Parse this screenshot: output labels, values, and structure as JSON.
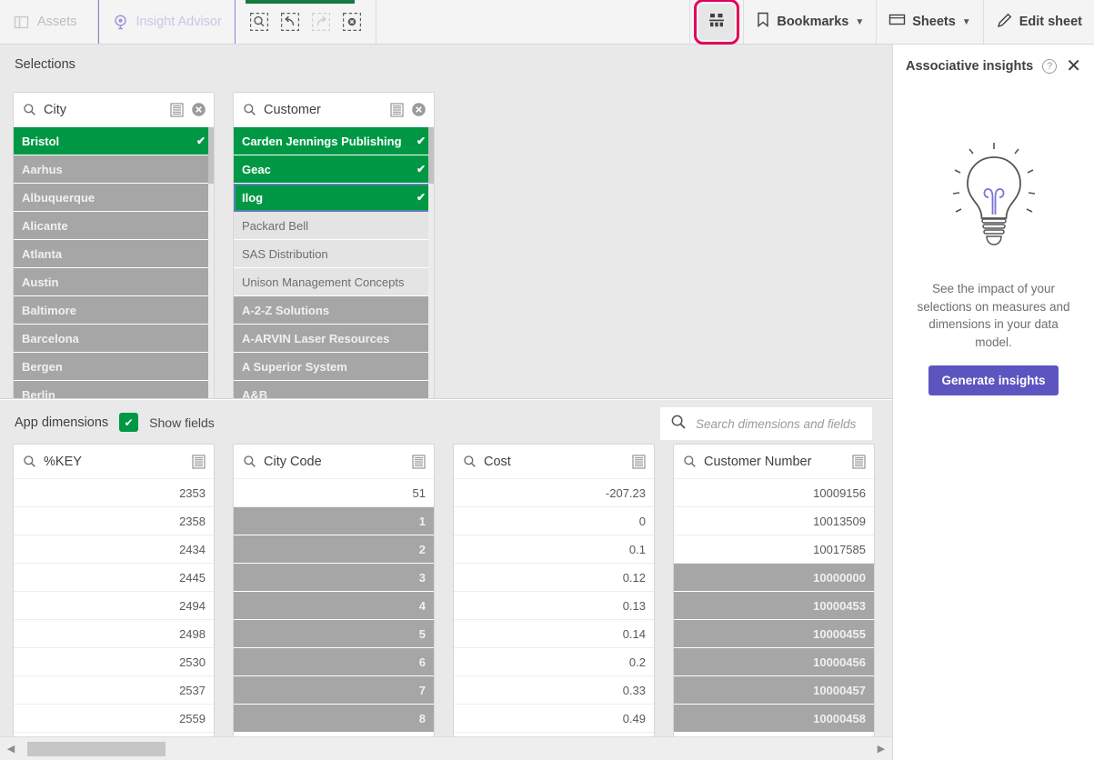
{
  "toolbar": {
    "assets_label": "Assets",
    "insight_advisor_label": "Insight Advisor",
    "tools": [
      {
        "name": "selection-search-icon"
      },
      {
        "name": "step-back-icon"
      },
      {
        "name": "step-forward-icon"
      },
      {
        "name": "clear-all-selections-icon"
      }
    ],
    "chart_button_name": "chart-view-button",
    "bookmarks_label": "Bookmarks",
    "sheets_label": "Sheets",
    "edit_sheet_label": "Edit sheet",
    "highlight_color": "#e2005a",
    "active_tab_underline_color": "#157a3d"
  },
  "selections": {
    "title": "Selections",
    "listboxes": [
      {
        "title": "City",
        "rows": [
          {
            "label": "Bristol",
            "state": "selected",
            "checked": true
          },
          {
            "label": "Aarhus",
            "state": "excluded"
          },
          {
            "label": "Albuquerque",
            "state": "excluded"
          },
          {
            "label": "Alicante",
            "state": "excluded"
          },
          {
            "label": "Atlanta",
            "state": "excluded"
          },
          {
            "label": "Austin",
            "state": "excluded"
          },
          {
            "label": "Baltimore",
            "state": "excluded"
          },
          {
            "label": "Barcelona",
            "state": "excluded"
          },
          {
            "label": "Bergen",
            "state": "excluded"
          },
          {
            "label": "Berlin",
            "state": "excluded"
          }
        ]
      },
      {
        "title": "Customer",
        "rows": [
          {
            "label": "Carden Jennings Publishing",
            "state": "selected",
            "checked": true
          },
          {
            "label": "Geac",
            "state": "selected",
            "checked": true
          },
          {
            "label": "Ilog",
            "state": "selected",
            "checked": true,
            "focused": true
          },
          {
            "label": "Packard Bell",
            "state": "alt"
          },
          {
            "label": "SAS Distribution",
            "state": "alt"
          },
          {
            "label": "Unison Management Concepts",
            "state": "alt"
          },
          {
            "label": "A-2-Z Solutions",
            "state": "excluded"
          },
          {
            "label": "A-ARVIN Laser Resources",
            "state": "excluded"
          },
          {
            "label": "A Superior System",
            "state": "excluded"
          },
          {
            "label": "A&B",
            "state": "excluded"
          }
        ]
      }
    ]
  },
  "app_dimensions": {
    "title": "App dimensions",
    "show_fields_label": "Show fields",
    "show_fields_checked": true,
    "search_placeholder": "Search dimensions and fields",
    "fields": [
      {
        "title": "%KEY",
        "rows": [
          {
            "label": "2353",
            "state": "optional"
          },
          {
            "label": "2358",
            "state": "optional"
          },
          {
            "label": "2434",
            "state": "optional"
          },
          {
            "label": "2445",
            "state": "optional"
          },
          {
            "label": "2494",
            "state": "optional"
          },
          {
            "label": "2498",
            "state": "optional"
          },
          {
            "label": "2530",
            "state": "optional"
          },
          {
            "label": "2537",
            "state": "optional"
          },
          {
            "label": "2559",
            "state": "optional"
          }
        ]
      },
      {
        "title": "City Code",
        "rows": [
          {
            "label": "51",
            "state": "optional"
          },
          {
            "label": "1",
            "state": "excluded"
          },
          {
            "label": "2",
            "state": "excluded"
          },
          {
            "label": "3",
            "state": "excluded"
          },
          {
            "label": "4",
            "state": "excluded"
          },
          {
            "label": "5",
            "state": "excluded"
          },
          {
            "label": "6",
            "state": "excluded"
          },
          {
            "label": "7",
            "state": "excluded"
          },
          {
            "label": "8",
            "state": "excluded"
          }
        ]
      },
      {
        "title": "Cost",
        "rows": [
          {
            "label": "-207.23",
            "state": "optional"
          },
          {
            "label": "0",
            "state": "optional"
          },
          {
            "label": "0.1",
            "state": "optional"
          },
          {
            "label": "0.12",
            "state": "optional"
          },
          {
            "label": "0.13",
            "state": "optional"
          },
          {
            "label": "0.14",
            "state": "optional"
          },
          {
            "label": "0.2",
            "state": "optional"
          },
          {
            "label": "0.33",
            "state": "optional"
          },
          {
            "label": "0.49",
            "state": "optional"
          }
        ]
      },
      {
        "title": "Customer Number",
        "rows": [
          {
            "label": "10009156",
            "state": "optional"
          },
          {
            "label": "10013509",
            "state": "optional"
          },
          {
            "label": "10017585",
            "state": "optional"
          },
          {
            "label": "10000000",
            "state": "excluded"
          },
          {
            "label": "10000453",
            "state": "excluded"
          },
          {
            "label": "10000455",
            "state": "excluded"
          },
          {
            "label": "10000456",
            "state": "excluded"
          },
          {
            "label": "10000457",
            "state": "excluded"
          },
          {
            "label": "10000458",
            "state": "excluded"
          }
        ]
      }
    ]
  },
  "insights": {
    "title": "Associative insights",
    "help_label": "?",
    "close_label": "✕",
    "description": "See the impact of your selections on measures and dimensions in your data model.",
    "button_label": "Generate insights",
    "button_color": "#5c55bf"
  },
  "scrollbar": {
    "left_arrow": "◀",
    "right_arrow": "▶"
  }
}
